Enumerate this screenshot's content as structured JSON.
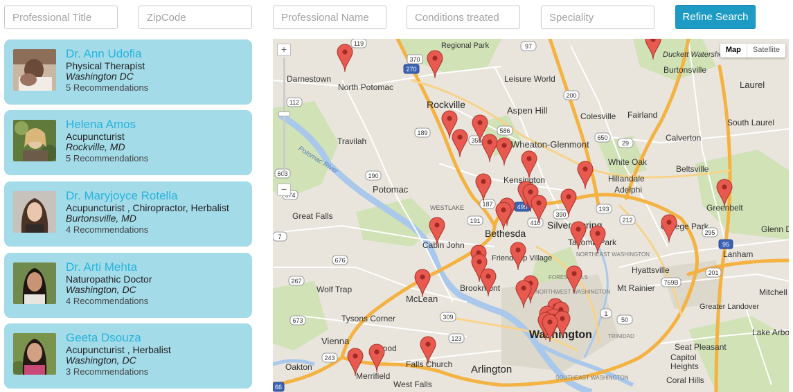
{
  "search": {
    "title_placeholder": "Professional Title",
    "zip_placeholder": "ZipCode",
    "name_placeholder": "Professional Name",
    "conditions_placeholder": "Conditions treated",
    "speciality_placeholder": "Speciality",
    "refine_label": "Refine Search"
  },
  "results": [
    {
      "name": "Dr. Ann Udofia",
      "title": "Physical Therapist",
      "location": "Washington DC",
      "recommendations": "5 Recommendations"
    },
    {
      "name": "Helena Amos",
      "title": "Acupuncturist",
      "location": "Rockville, MD",
      "recommendations": "5 Recommendations"
    },
    {
      "name": "Dr. Maryjoyce Rotella",
      "title": "Acupuncturist , Chiropractor, Herbalist",
      "location": "Burtonsville, MD",
      "recommendations": "4 Recommendations"
    },
    {
      "name": "Dr. Arti Mehta",
      "title": "Naturopathic Doctor",
      "location": "Washington, DC",
      "recommendations": "4 Recommendations"
    },
    {
      "name": "Geeta Dsouza",
      "title": "Acupuncturist , Herbalist",
      "location": "Washington, DC",
      "recommendations": "3 Recommendations"
    }
  ],
  "map": {
    "type_map": "Map",
    "type_satellite": "Satellite",
    "zoom_in": "+",
    "zoom_out": "−",
    "marker_color": "#e85a50",
    "labels": {
      "regional_park": "Regional Park",
      "duckett": "Duckett Watershed",
      "darnestown": "Darnestown",
      "north_potomac": "North Potomac",
      "leisure_world": "Leisure World",
      "burtonsville": "Burtonsville",
      "laurel": "Laurel",
      "rockville": "Rockville",
      "aspen_hill": "Aspen Hill",
      "colesville": "Colesville",
      "fairland": "Fairland",
      "south_laurel": "South Laurel",
      "travilah": "Travilah",
      "wheaton": "Wheaton-Glenmont",
      "calverton": "Calverton",
      "white_oak": "White Oak",
      "beltsville": "Beltsville",
      "potomac_river": "Potomac River",
      "potomac": "Potomac",
      "kensington": "Kensington",
      "hillandale": "Hillandale",
      "greenbelt": "Greenbelt",
      "westlake": "WESTLAKE",
      "adelphi": "Adelphi",
      "great_falls": "Great Falls",
      "bethesda": "Bethesda",
      "silver_spring": "Silver Spring",
      "college_park": "College Park",
      "glenn_dale": "Glenn Da",
      "cabin_john": "Cabin John",
      "takoma_park": "Takoma Park",
      "friendship": "Friendship Village",
      "lanham": "Lanham",
      "northeast_washington": "NORTHEAST WASHINGTON",
      "hyattsville": "Hyattsville",
      "wolf_trap": "Wolf Trap",
      "brookmont": "Brookmont",
      "northwest_washington": "NORTHWEST WASHINGTON",
      "mt_rainier": "Mt Rainier",
      "mclean": "McLean",
      "mitchellville": "Mitchell",
      "greater_landover": "Greater Landover",
      "tysons_corner": "Tysons Corner",
      "washington": "Washington",
      "trinidad": "TRINIDAD",
      "lake_arbor": "Lake Arbor",
      "vienna": "Vienna",
      "seat_pleasant": "Seat Pleasant",
      "oakton": "Oakton",
      "merrifield": "Merrifield",
      "falls_church": "Falls Church",
      "arlington": "Arlington",
      "capitol_heights": "Capitol Heights",
      "southeast_washington": "SOUTHEAST WASHINGTON",
      "coral_hills": "Coral Hills",
      "west_falls": "West Falls",
      "forest_hills": "FOREST HILLS",
      "wood": "wood"
    },
    "routes": [
      "119",
      "370",
      "270",
      "97",
      "200",
      "112",
      "189",
      "586",
      "650",
      "29",
      "190",
      "187",
      "495",
      "193",
      "212",
      "674",
      "191",
      "390",
      "410",
      "7",
      "676",
      "267",
      "673",
      "309",
      "123",
      "243",
      "66",
      "1",
      "50",
      "295",
      "95",
      "201",
      "769B",
      "603",
      "355"
    ]
  }
}
